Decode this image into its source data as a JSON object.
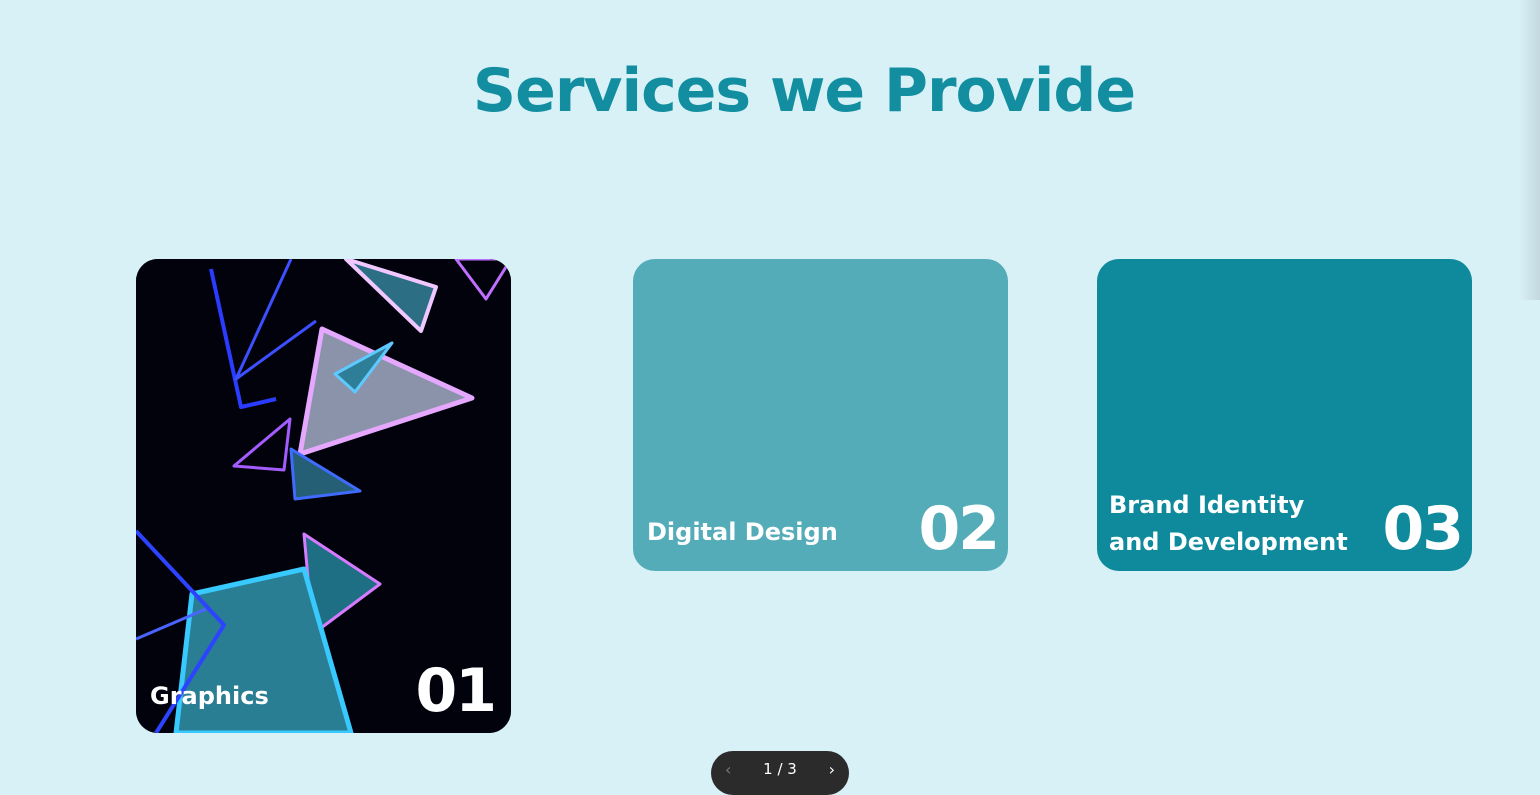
{
  "section": {
    "title": "Services we Provide"
  },
  "colors": {
    "background": "#d8f1f7",
    "title": "#128ea0",
    "card_2": "#55acb9",
    "card_3": "#0e8a9c",
    "card_1": "#02020c"
  },
  "cards": [
    {
      "label": "Graphics",
      "number": "01",
      "image": "neon-triangles-artwork"
    },
    {
      "label": "Digital Design",
      "number": "02"
    },
    {
      "label": "Brand Identity\nand Development",
      "number": "03"
    }
  ],
  "pager": {
    "status": "1 / 3",
    "prev_icon": "chevron-left-icon",
    "next_icon": "chevron-right-icon"
  }
}
